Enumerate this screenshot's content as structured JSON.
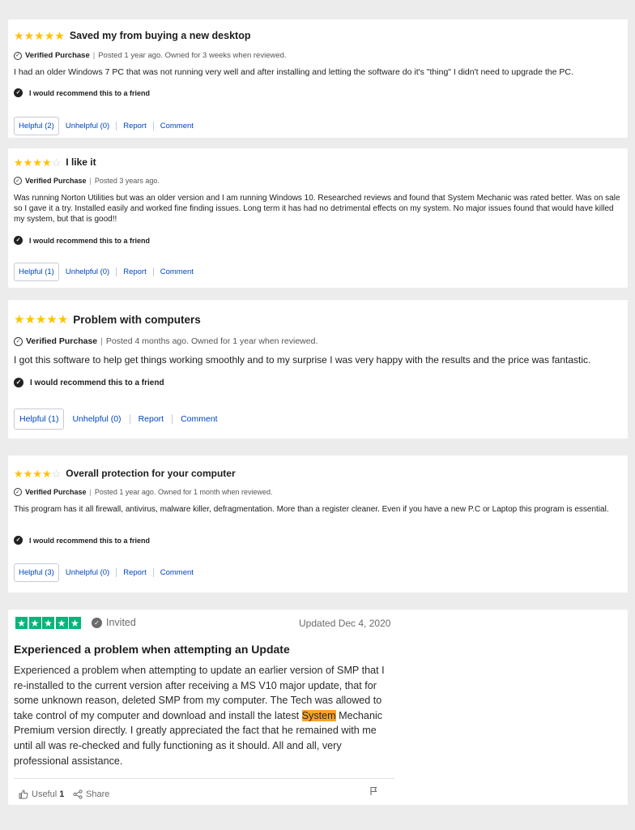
{
  "reviews": [
    {
      "rating": 5,
      "title": "Saved my from buying a new desktop",
      "verified_label": "Verified Purchase",
      "posted": "Posted 1 year ago. Owned for 3 weeks when reviewed.",
      "body": "I had an older Windows 7 PC that was not running very well and after installing and letting  the software do it's \"thing\" I didn't need to upgrade the PC.",
      "recommend": "I would recommend this to a friend",
      "helpful": "Helpful (2)",
      "unhelpful": "Unhelpful (0)",
      "report": "Report",
      "comment": "Comment"
    },
    {
      "rating": 4,
      "title": "I like it",
      "verified_label": "Verified Purchase",
      "posted": "Posted 3 years ago.",
      "body": "Was running Norton Utilities but was an older version and I am running Windows 10. Researched reviews and found that System Mechanic was rated better. Was on sale so I gave it a try. Installed easily and worked fine finding issues. Long term it has had no detrimental effects on my system. No major issues found that would have killed my system, but that is good!!",
      "recommend": "I would recommend this to a friend",
      "helpful": "Helpful (1)",
      "unhelpful": "Unhelpful (0)",
      "report": "Report",
      "comment": "Comment"
    },
    {
      "rating": 5,
      "title": "Problem with computers",
      "verified_label": "Verified Purchase",
      "posted": "Posted 4 months ago. Owned for 1 year when reviewed.",
      "body": "I got this software to help get things working smoothly and to my surprise I was very happy with the results and the price was fantastic.",
      "recommend": "I would recommend this to a friend",
      "helpful": "Helpful (1)",
      "unhelpful": "Unhelpful (0)",
      "report": "Report",
      "comment": "Comment"
    },
    {
      "rating": 4,
      "title": "Overall protection for your computer",
      "verified_label": "Verified Purchase",
      "posted": "Posted 1 year ago. Owned for 1 month when reviewed.",
      "body": "This program has it all firewall, antivirus, malware killer, defragmentation. More than a register cleaner. Even if you have a new P.C or Laptop this program is essential.",
      "recommend": "I would recommend this to a friend",
      "helpful": "Helpful (3)",
      "unhelpful": "Unhelpful (0)",
      "report": "Report",
      "comment": "Comment"
    }
  ],
  "trustpilot": {
    "rating": 5,
    "invited": "Invited",
    "date": "Updated Dec 4, 2020",
    "title": "Experienced a problem when attempting an Update",
    "body_before": "Experienced a problem when attempting to update an earlier version of SMP that I re-installed to the current version after receiving a MS V10 major update, that for some unknown reason, deleted SMP from my computer. The Tech was allowed to take control of my computer and download and install the latest ",
    "body_highlight": "System",
    "body_after": " Mechanic Premium version directly. I greatly appreciated the fact that he remained with me until all was re-checked and fully functioning as it should. All and all, very professional assistance.",
    "useful_label": "Useful",
    "useful_count": "1",
    "share_label": "Share"
  },
  "colors": {
    "star": "#ffc200",
    "link": "#0046be",
    "trustpilot_green": "#00b67a",
    "highlight": "#f7a32b"
  }
}
